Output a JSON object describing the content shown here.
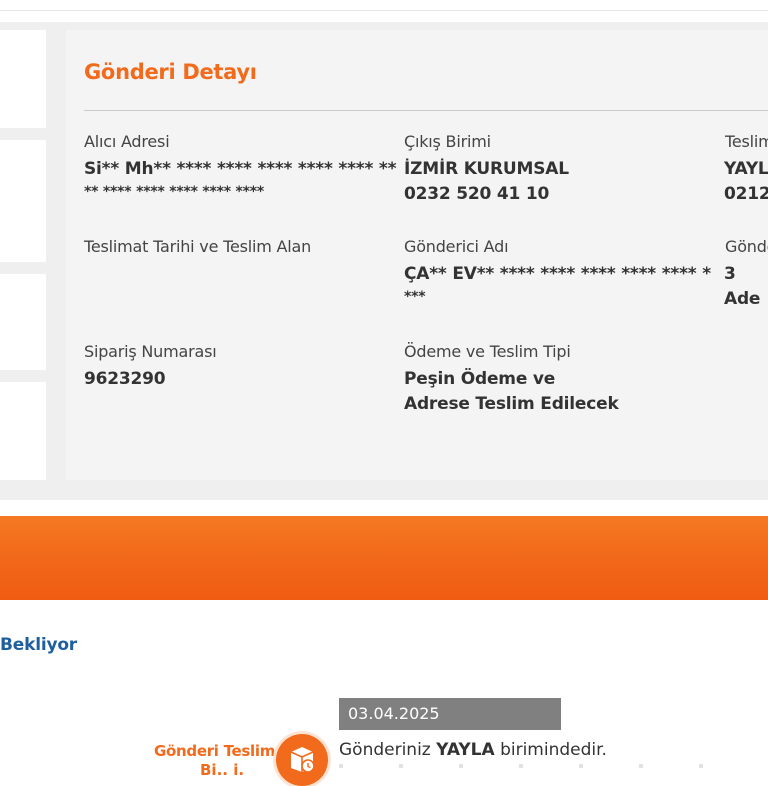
{
  "detail": {
    "title": "Gönderi Detayı",
    "fields": [
      {
        "label": "Alıcı Adresi",
        "value": "Si** Mh** **** **** **** **** **** **",
        "value2": "** **** **** **** **** ****"
      },
      {
        "label": "Çıkış Birimi",
        "value": "İZMİR KURUMSAL",
        "value2": "0232 520 41 10"
      },
      {
        "label": "Teslim",
        "value": "YAYL",
        "value2": "0212"
      },
      {
        "label": "Teslimat Tarihi ve Teslim Alan",
        "value": "",
        "value2": ""
      },
      {
        "label": "Gönderici Adı",
        "value": "ÇA** EV** **** **** **** **** **** *",
        "value2": "***"
      },
      {
        "label": "Gönde",
        "value": "3 Ade",
        "value2": ""
      },
      {
        "label": "Sipariş Numarası",
        "value": "9623290",
        "value2": ""
      },
      {
        "label": "Ödeme ve Teslim Tipi",
        "value": "Peşin Ödeme ve",
        "value2": "Adrese Teslim Edilecek"
      }
    ]
  },
  "status": {
    "text": "Bekliyor"
  },
  "timeline": {
    "date": "03.04.2025",
    "step_label": "Gönderi Teslimat",
    "step_label2": "Bi.. i.",
    "icon": "delivery-box-icon",
    "message_prefix": "Gönderiniz",
    "message_bold": "YAYLA",
    "message_suffix": "birimindedir."
  },
  "colors": {
    "accent": "#f26a1b",
    "status_blue": "#1f5f9e",
    "badge_grey": "#808080"
  }
}
